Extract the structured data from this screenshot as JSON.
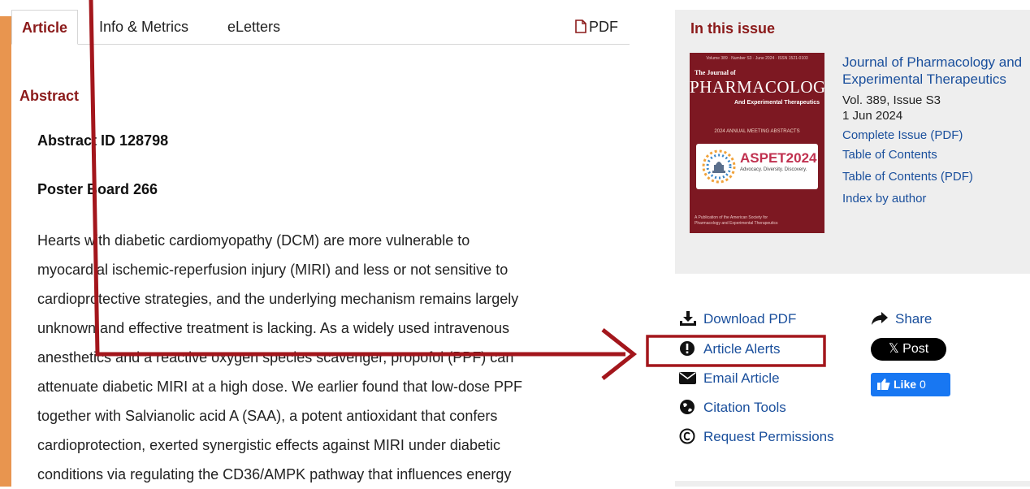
{
  "tabs": {
    "article": "Article",
    "info_metrics": "Info & Metrics",
    "eletters": "eLetters",
    "pdf": "PDF"
  },
  "abstract": {
    "heading": "Abstract",
    "abstract_id": "Abstract ID 128798",
    "poster_board": "Poster Board 266",
    "lines": [
      "Hearts with diabetic cardiomyopathy (DCM) are more vulnerable to",
      "myocardial ischemic-reperfusion injury (MIRI) and less or not sensitive to",
      "cardioprotective strategies, and the underlying mechanism remains largely",
      "unknown and effective treatment is lacking. As a widely used intravenous",
      "anesthetics and a reactive oxygen species scavenger, propofol (PPF) can",
      "attenuate diabetic MIRI at a high dose. We earlier found that low-dose PPF",
      "together with Salvianolic acid A (SAA), a potent antioxidant that confers",
      "cardioprotection, exerted synergistic effects against MIRI under diabetic",
      "conditions via regulating the CD36/AMPK pathway that influences energy"
    ]
  },
  "issue": {
    "heading": "In this issue",
    "cover": {
      "small_top": "Volume 389 · Number S3 · June 2024 · ISSN 1521-0103",
      "journal_of": "The Journal of",
      "title": "PHARMACOLOGY",
      "subtitle": "And Experimental Therapeutics",
      "meeting": "2024 ANNUAL MEETING ABSTRACTS",
      "aspet": "ASPET2024",
      "aspet_sub": "Advocacy. Diversity. Discovery.",
      "foot": "A Publication of the American Society for Pharmacology and Experimental Therapeutics"
    },
    "journal": "Journal of Pharmacology and Experimental Therapeutics",
    "volume": "Vol. 389, Issue S3",
    "date": "1 Jun 2024",
    "links": [
      "Complete Issue (PDF)",
      "Table of Contents",
      "Table of Contents (PDF)",
      "Index by author"
    ]
  },
  "tools": {
    "download_pdf": "Download PDF",
    "article_alerts": "Article Alerts",
    "email_article": "Email Article",
    "citation_tools": "Citation Tools",
    "request_permissions": "Request Permissions",
    "share": "Share",
    "x_post": "𝕏 Post",
    "like": "Like",
    "like_count": "0"
  },
  "colors": {
    "accent_red": "#8b1a1a",
    "link_blue": "#1a4f9c",
    "annotation_red": "#a3161c",
    "left_accent": "#e8954f"
  }
}
